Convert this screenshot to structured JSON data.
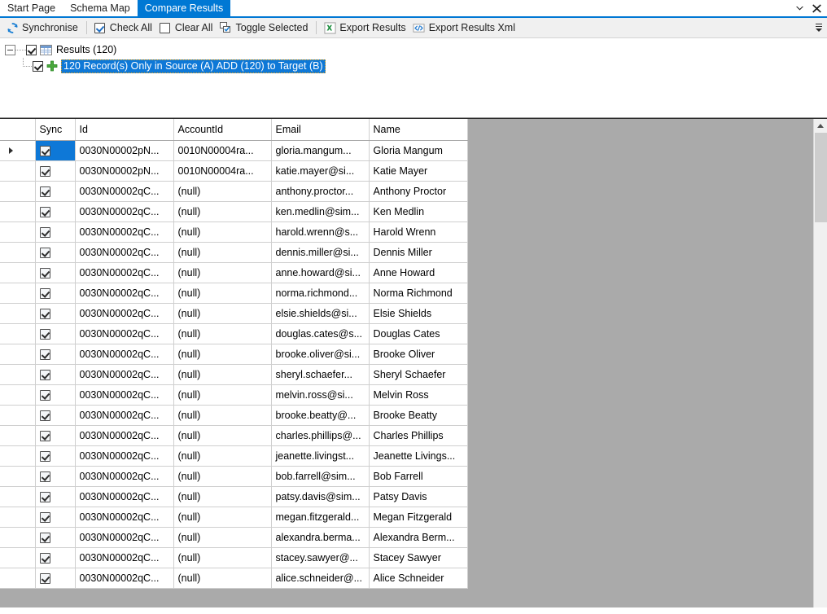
{
  "window": {
    "tab_dropdown_icon": "chevron-down-icon",
    "close_icon": "close-icon"
  },
  "tabs": [
    {
      "label": "Start Page",
      "active": false
    },
    {
      "label": "Schema Map",
      "active": false
    },
    {
      "label": "Compare Results",
      "active": true
    }
  ],
  "toolbar": {
    "synchronise_label": "Synchronise",
    "check_all_label": "Check All",
    "clear_all_label": "Clear All",
    "toggle_selected_label": "Toggle Selected",
    "export_results_label": "Export Results",
    "export_results_xml_label": "Export Results Xml",
    "overflow_icon": "toolbar-overflow-icon",
    "icons": {
      "synchronise": "refresh-icon",
      "check_all": "checked-checkbox-icon",
      "clear_all": "empty-checkbox-icon",
      "toggle_selected": "toggle-checkbox-icon",
      "export_results": "excel-icon",
      "export_results_xml": "xml-icon"
    }
  },
  "tree": {
    "root": {
      "label": "Results (120)",
      "icon": "grid-table-icon",
      "checked": true,
      "expanded": true
    },
    "child": {
      "label": "120 Record(s) Only in Source (A) ADD (120) to Target (B)",
      "icon": "plus-add-icon",
      "checked": true,
      "selected": true
    }
  },
  "grid": {
    "columns": [
      "",
      "Sync",
      "Id",
      "AccountId",
      "Email",
      "Name"
    ],
    "rows": [
      {
        "current": true,
        "checked": true,
        "id": "0030N00002pN...",
        "account": "0010N00004ra...",
        "email": "gloria.mangum...",
        "name": "Gloria Mangum"
      },
      {
        "current": false,
        "checked": true,
        "id": "0030N00002pN...",
        "account": "0010N00004ra...",
        "email": "katie.mayer@si...",
        "name": "Katie Mayer"
      },
      {
        "current": false,
        "checked": true,
        "id": "0030N00002qC...",
        "account": "(null)",
        "email": "anthony.proctor...",
        "name": "Anthony Proctor"
      },
      {
        "current": false,
        "checked": true,
        "id": "0030N00002qC...",
        "account": "(null)",
        "email": "ken.medlin@sim...",
        "name": "Ken Medlin"
      },
      {
        "current": false,
        "checked": true,
        "id": "0030N00002qC...",
        "account": "(null)",
        "email": "harold.wrenn@s...",
        "name": "Harold Wrenn"
      },
      {
        "current": false,
        "checked": true,
        "id": "0030N00002qC...",
        "account": "(null)",
        "email": "dennis.miller@si...",
        "name": "Dennis Miller"
      },
      {
        "current": false,
        "checked": true,
        "id": "0030N00002qC...",
        "account": "(null)",
        "email": "anne.howard@si...",
        "name": "Anne Howard"
      },
      {
        "current": false,
        "checked": true,
        "id": "0030N00002qC...",
        "account": "(null)",
        "email": "norma.richmond...",
        "name": "Norma Richmond"
      },
      {
        "current": false,
        "checked": true,
        "id": "0030N00002qC...",
        "account": "(null)",
        "email": "elsie.shields@si...",
        "name": "Elsie Shields"
      },
      {
        "current": false,
        "checked": true,
        "id": "0030N00002qC...",
        "account": "(null)",
        "email": "douglas.cates@s...",
        "name": "Douglas Cates"
      },
      {
        "current": false,
        "checked": true,
        "id": "0030N00002qC...",
        "account": "(null)",
        "email": "brooke.oliver@si...",
        "name": "Brooke Oliver"
      },
      {
        "current": false,
        "checked": true,
        "id": "0030N00002qC...",
        "account": "(null)",
        "email": "sheryl.schaefer...",
        "name": "Sheryl Schaefer"
      },
      {
        "current": false,
        "checked": true,
        "id": "0030N00002qC...",
        "account": "(null)",
        "email": "melvin.ross@si...",
        "name": "Melvin Ross"
      },
      {
        "current": false,
        "checked": true,
        "id": "0030N00002qC...",
        "account": "(null)",
        "email": "brooke.beatty@...",
        "name": "Brooke Beatty"
      },
      {
        "current": false,
        "checked": true,
        "id": "0030N00002qC...",
        "account": "(null)",
        "email": "charles.phillips@...",
        "name": "Charles Phillips"
      },
      {
        "current": false,
        "checked": true,
        "id": "0030N00002qC...",
        "account": "(null)",
        "email": "jeanette.livingst...",
        "name": "Jeanette Livings..."
      },
      {
        "current": false,
        "checked": true,
        "id": "0030N00002qC...",
        "account": "(null)",
        "email": "bob.farrell@sim...",
        "name": "Bob Farrell"
      },
      {
        "current": false,
        "checked": true,
        "id": "0030N00002qC...",
        "account": "(null)",
        "email": "patsy.davis@sim...",
        "name": "Patsy Davis"
      },
      {
        "current": false,
        "checked": true,
        "id": "0030N00002qC...",
        "account": "(null)",
        "email": "megan.fitzgerald...",
        "name": "Megan Fitzgerald"
      },
      {
        "current": false,
        "checked": true,
        "id": "0030N00002qC...",
        "account": "(null)",
        "email": "alexandra.berma...",
        "name": "Alexandra Berm..."
      },
      {
        "current": false,
        "checked": true,
        "id": "0030N00002qC...",
        "account": "(null)",
        "email": "stacey.sawyer@...",
        "name": "Stacey Sawyer"
      },
      {
        "current": false,
        "checked": true,
        "id": "0030N00002qC...",
        "account": "(null)",
        "email": "alice.schneider@...",
        "name": "Alice Schneider"
      }
    ]
  },
  "scrollbar": {
    "up_arrow_icon": "scroll-up-arrow-icon",
    "thumb": "scroll-thumb"
  },
  "colors": {
    "accent": "#0078d4",
    "selection": "#0e78d7",
    "sync_cell": "#7d8996",
    "canvas": "#aaaaaa",
    "toolbar": "#f0f0f0"
  }
}
